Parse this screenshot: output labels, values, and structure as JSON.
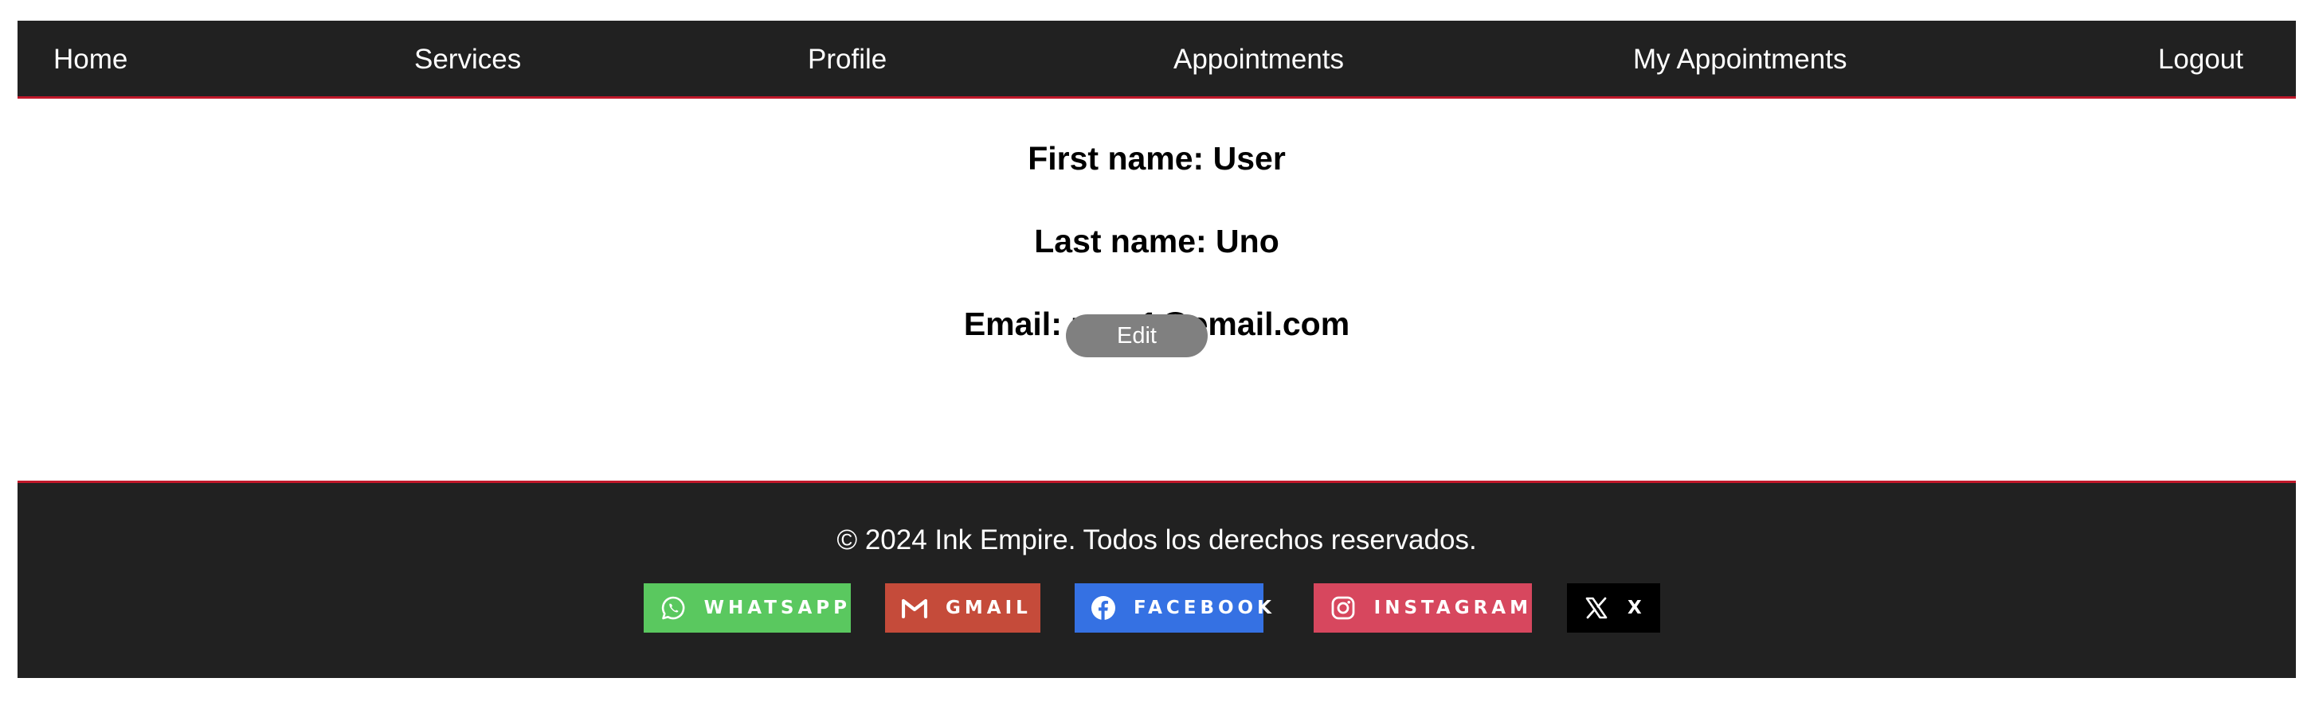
{
  "nav": {
    "home": "Home",
    "services": "Services",
    "profile": "Profile",
    "appointments": "Appointments",
    "my_appointments": "My Appointments",
    "logout": "Logout"
  },
  "profile": {
    "first_name": "First name: User",
    "last_name": "Last name: Uno",
    "email": "Email: user1@email.com",
    "edit_label": "Edit"
  },
  "footer": {
    "copyright": "© 2024 Ink Empire. Todos los derechos reservados.",
    "social": [
      {
        "label": "WHATSAPP",
        "icon": "whatsapp-icon",
        "color": "#5ac85f"
      },
      {
        "label": "GMAIL",
        "icon": "gmail-icon",
        "color": "#c54b3a"
      },
      {
        "label": "FACEBOOK",
        "icon": "facebook-icon",
        "color": "#3571e3"
      },
      {
        "label": "INSTAGRAM",
        "icon": "instagram-icon",
        "color": "#d7475e"
      },
      {
        "label": "X",
        "icon": "x-icon",
        "color": "#000000"
      }
    ]
  },
  "colors": {
    "nav_bg": "#212121",
    "accent_border": "#c0182a",
    "edit_button": "#808080"
  }
}
